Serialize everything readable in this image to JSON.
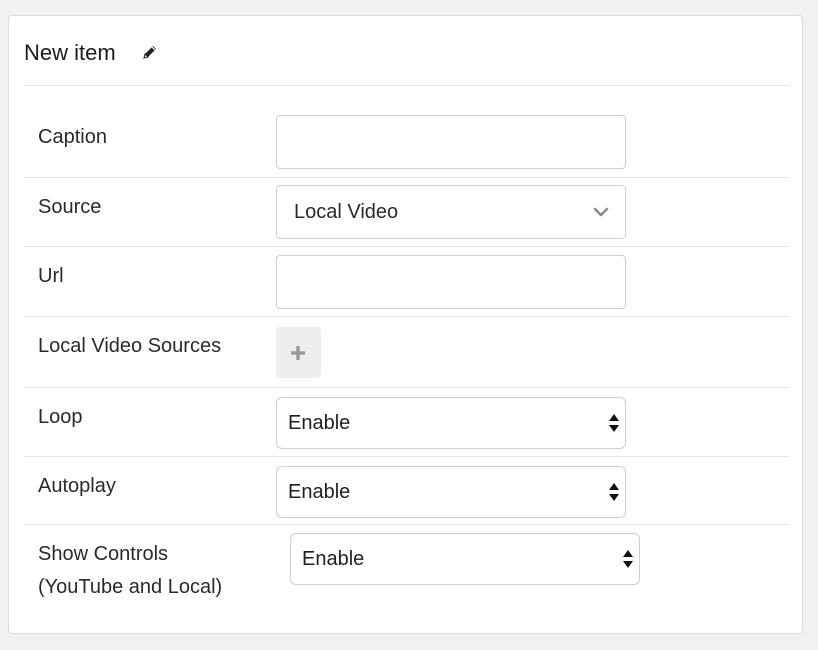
{
  "panel": {
    "title": "New item"
  },
  "fields": {
    "caption": {
      "label": "Caption",
      "value": ""
    },
    "source": {
      "label": "Source",
      "value": "Local Video"
    },
    "url": {
      "label": "Url",
      "value": ""
    },
    "local_video_sources": {
      "label": "Local Video Sources"
    },
    "loop": {
      "label": "Loop",
      "value": "Enable"
    },
    "autoplay": {
      "label": "Autoplay",
      "value": "Enable"
    },
    "show_controls": {
      "label_line1": "Show Controls",
      "label_line2": "(YouTube and Local)",
      "value": "Enable"
    }
  },
  "icons": {
    "title_edit": "pencil-icon",
    "source_dropdown": "chevron-down-icon",
    "select_arrows": "up-down-arrows-icon",
    "add": "plus-icon"
  },
  "colors": {
    "page_bg": "#f1f1f1",
    "panel_bg": "#ffffff",
    "border": "#cfcfcf",
    "divider": "#e6e6e6",
    "add_button_bg": "#eeeeee",
    "icon_gray": "#9a9a9a"
  }
}
